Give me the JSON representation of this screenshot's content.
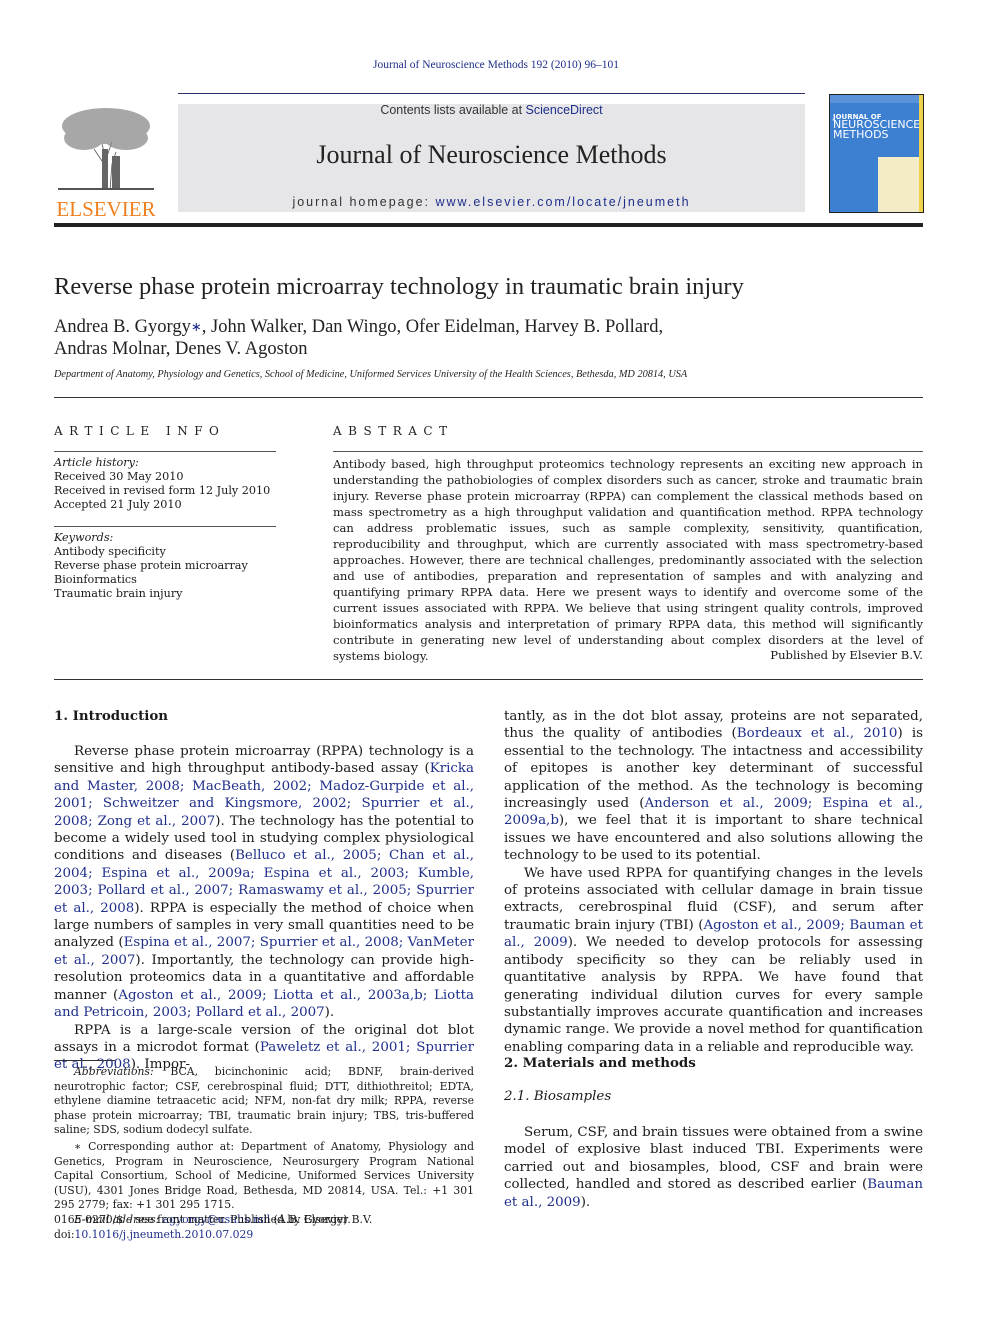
{
  "running_head": "Journal of Neuroscience Methods 192 (2010) 96–101",
  "masthead": {
    "publisher_logo_text": "ELSEVIER",
    "contents_prefix": "Contents lists available at ",
    "contents_link": "ScienceDirect",
    "journal_name": "Journal of Neuroscience Methods",
    "homepage_prefix": "journal homepage: ",
    "homepage_link": "www.elsevier.com/locate/jneumeth",
    "cover_line1": "JOURNAL OF",
    "cover_line2": "NEUROSCIENCE",
    "cover_line3": "METHODS"
  },
  "colors": {
    "link": "#1f2f8a",
    "elsevier_orange": "#f07f1e",
    "masthead_bg": "#e6e6e8",
    "cover_blue": "#3d7fd1"
  },
  "article": {
    "title": "Reverse phase protein microarray technology in traumatic brain injury",
    "authors_line1_a": "Andrea B. Gyorgy",
    "authors_star": "∗",
    "authors_line1_b": ", John Walker, Dan Wingo, Ofer Eidelman, Harvey B. Pollard,",
    "authors_line2": "Andras Molnar, Denes V. Agoston",
    "affiliation": "Department of Anatomy, Physiology and Genetics, School of Medicine, Uniformed Services University of the Health Sciences, Bethesda, MD 20814, USA"
  },
  "article_info": {
    "heading": "ARTICLE INFO",
    "history_label": "Article history:",
    "history": [
      "Received 30 May 2010",
      "Received in revised form 12 July 2010",
      "Accepted 21 July 2010"
    ],
    "keywords_label": "Keywords:",
    "keywords": [
      "Antibody specificity",
      "Reverse phase protein microarray",
      "Bioinformatics",
      "Traumatic brain injury"
    ]
  },
  "abstract": {
    "heading": "ABSTRACT",
    "text": "Antibody based, high throughput proteomics technology represents an exciting new approach in understanding the pathobiologies of complex disorders such as cancer, stroke and traumatic brain injury. Reverse phase protein microarray (RPPA) can complement the classical methods based on mass spectrometry as a high throughput validation and quantification method. RPPA technology can address problematic issues, such as sample complexity, sensitivity, quantification, reproducibility and throughput, which are currently associated with mass spectrometry-based approaches. However, there are technical challenges, predominantly associated with the selection and use of antibodies, preparation and representation of samples and with analyzing and quantifying primary RPPA data. Here we present ways to identify and overcome some of the current issues associated with RPPA. We believe that using stringent quality controls, improved bioinformatics analysis and interpretation of primary RPPA data, this method will significantly contribute in generating new level of understanding about complex disorders at the level of systems biology.",
    "publisher_note": "Published by Elsevier B.V."
  },
  "intro": {
    "heading": "1.  Introduction",
    "p1": [
      {
        "t": "Reverse phase protein microarray (RPPA) technology is a sensitive and high throughput antibody-based assay ("
      },
      {
        "c": "Kricka and Master, 2008; MacBeath, 2002; Madoz-Gurpide et al., 2001; Schweitzer and Kingsmore, 2002; Spurrier et al., 2008; Zong et al., 2007"
      },
      {
        "t": "). The technology has the potential to become a widely used tool in studying complex physiological conditions and diseases ("
      },
      {
        "c": "Belluco et al., 2005; Chan et al., 2004; Espina et al., 2009a; Espina et al., 2003; Kumble, 2003; Pollard et al., 2007; Ramaswamy et al., 2005; Spurrier et al., 2008"
      },
      {
        "t": "). RPPA is especially the method of choice when large numbers of samples in very small quantities need to be analyzed ("
      },
      {
        "c": "Espina et al., 2007; Spurrier et al., 2008; VanMeter et al., 2007"
      },
      {
        "t": "). Importantly, the technology can provide high-resolution proteomics data in a quantitative and affordable manner ("
      },
      {
        "c": "Agoston et al., 2009; Liotta et al., 2003a,b; Liotta and Petricoin, 2003; Pollard et al., 2007"
      },
      {
        "t": ")."
      }
    ],
    "p2": [
      {
        "t": "RPPA is a large-scale version of the original dot blot assays in a microdot format ("
      },
      {
        "c": "Paweletz et al., 2001; Spurrier et al., 2008"
      },
      {
        "t": "). Impor-"
      }
    ],
    "p2_cont": [
      {
        "t": "tantly, as in the dot blot assay, proteins are not separated, thus the quality of antibodies ("
      },
      {
        "c": "Bordeaux et al., 2010"
      },
      {
        "t": ") is essential to the technology. The intactness and accessibility of epitopes is another key determinant of successful application of the method. As the technology is becoming increasingly used ("
      },
      {
        "c": "Anderson et al., 2009; Espina et al., 2009a,b"
      },
      {
        "t": "), we feel that it is important to share technical issues we have encountered and also solutions allowing the technology to be used to its potential."
      }
    ],
    "p3": [
      {
        "t": "We have used RPPA for quantifying changes in the levels of proteins associated with cellular damage in brain tissue extracts, cerebrospinal fluid (CSF), and serum after traumatic brain injury (TBI) ("
      },
      {
        "c": "Agoston et al., 2009; Bauman et al., 2009"
      },
      {
        "t": "). We needed to develop protocols for assessing antibody specificity so they can be reliably used in quantitative analysis by RPPA. We have found that generating individual dilution curves for every sample substantially improves accurate quantification and increases dynamic range. We provide a novel method for quantification enabling comparing data in a reliable and reproducible way."
      }
    ]
  },
  "methods": {
    "heading": "2.  Materials and methods",
    "subheading": "2.1.  Biosamples",
    "p1": [
      {
        "t": "Serum, CSF, and brain tissues were obtained from a swine model of explosive blast induced TBI. Experiments were carried out and biosamples, blood, CSF and brain were collected, handled and stored as described earlier ("
      },
      {
        "c": "Bauman et al., 2009"
      },
      {
        "t": ")."
      }
    ]
  },
  "footnotes": {
    "abbrev_label": "Abbreviations:",
    "abbrev_text": " BCA, bicinchoninic acid; BDNF, brain-derived neurotrophic factor; CSF, cerebrospinal fluid; DTT, dithiothreitol; EDTA, ethylene diamine tetraacetic acid; NFM, non-fat dry milk; RPPA, reverse phase protein microarray; TBI, traumatic brain injury; TBS, tris-buffered saline; SDS, sodium dodecyl sulfate.",
    "corresponding": "∗ Corresponding author at: Department of Anatomy, Physiology and Genetics, Program in Neuroscience, Neurosurgery Program National Capital Consortium, School of Medicine, Uniformed Services University (USU), 4301 Jones Bridge Road, Bethesda, MD 20814, USA. Tel.: +1 301 295 2779; fax: +1 301 295 1715.",
    "email_label": "E-mail address:",
    "email": "agyorgy@usuhs.mil",
    "email_suffix": " (A.B. Gyorgy)."
  },
  "front_matter": {
    "issn_line": "0165-0270/$ – see front matter. Published by Elsevier B.V.",
    "doi_prefix": "doi:",
    "doi": "10.1016/j.jneumeth.2010.07.029"
  }
}
